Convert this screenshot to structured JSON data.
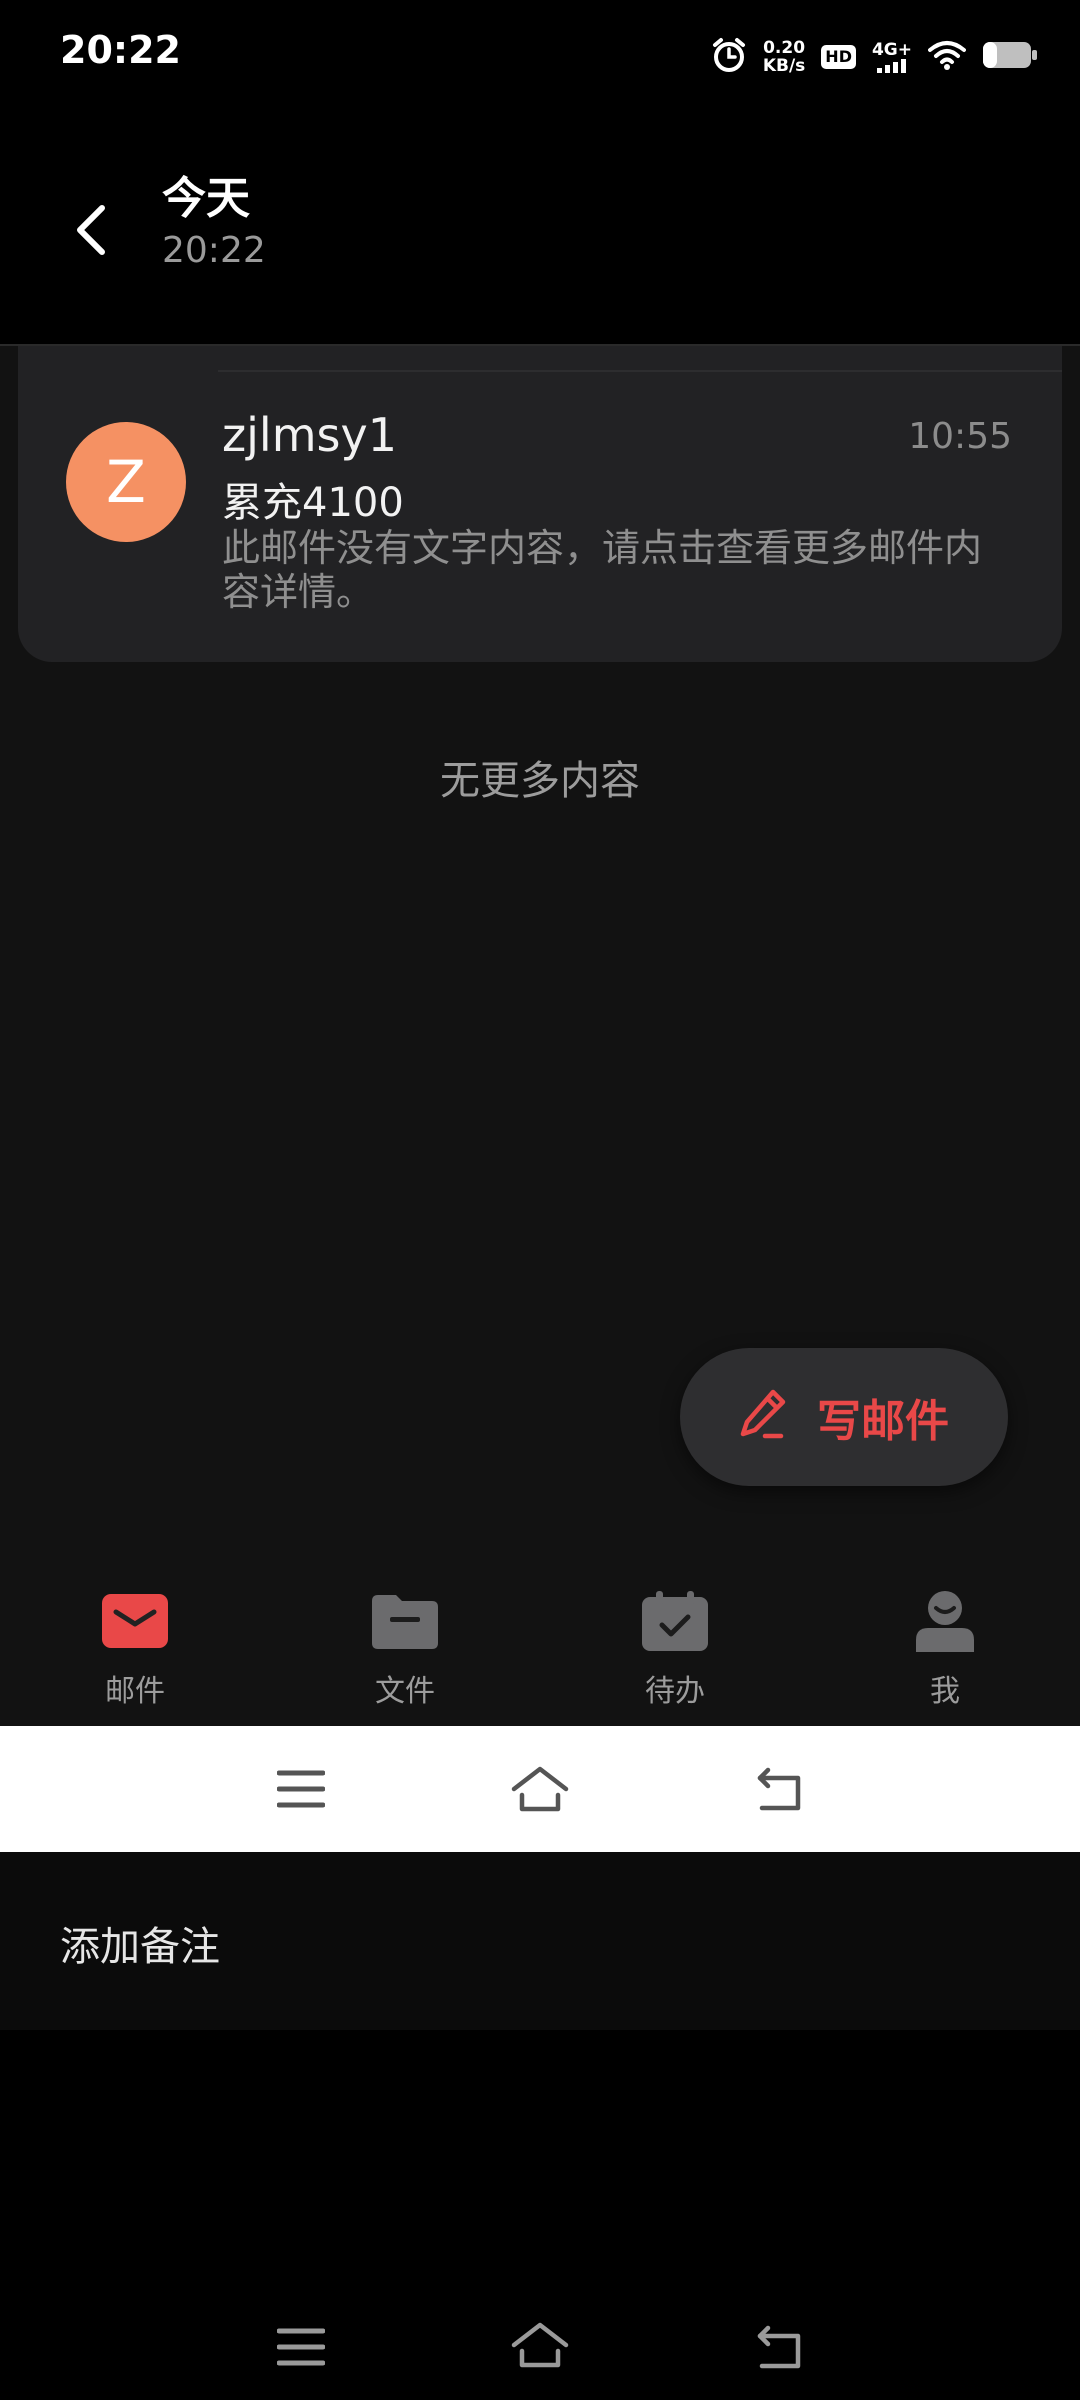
{
  "status_bar": {
    "time": "20:22",
    "net_speed_value": "0.20",
    "net_speed_unit": "KB/s",
    "hd_badge": "HD",
    "network_type": "4G+",
    "icons": [
      "alarm-icon",
      "hd-icon",
      "signal-icon",
      "wifi-icon",
      "battery-icon"
    ]
  },
  "header": {
    "title": "今天",
    "subtitle": "20:22"
  },
  "mail_list": {
    "items": [
      {
        "avatar_letter": "Z",
        "avatar_color": "#f59163",
        "sender": "zjlmsy1",
        "time": "10:55",
        "subject": "累充4100",
        "preview": "此邮件没有文字内容，请点击查看更多邮件内容详情。"
      }
    ],
    "end_text": "无更多内容"
  },
  "compose_button": {
    "label": "写邮件",
    "color": "#e94848"
  },
  "tabs": [
    {
      "label": "邮件",
      "icon": "mail-icon",
      "active": true
    },
    {
      "label": "文件",
      "icon": "folder-icon",
      "active": false
    },
    {
      "label": "待办",
      "icon": "calendar-check-icon",
      "active": false
    },
    {
      "label": "我",
      "icon": "profile-icon",
      "active": false
    }
  ],
  "note_bar": {
    "label": "添加备注"
  },
  "colors": {
    "accent": "#e94848",
    "background": "#121212",
    "card": "#222224"
  }
}
